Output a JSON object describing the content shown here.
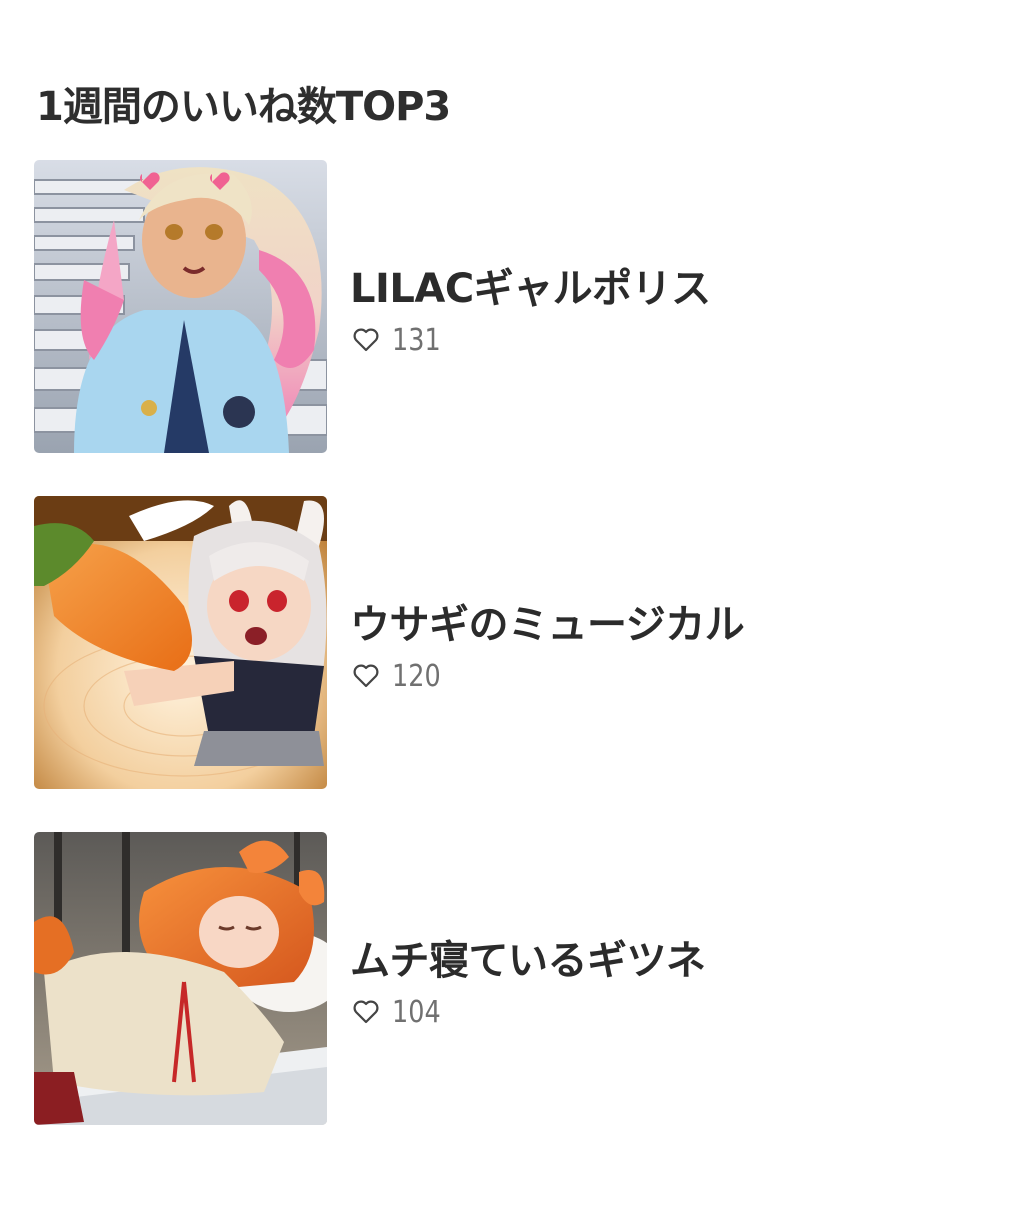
{
  "section": {
    "title": "1週間のいいね数TOP3"
  },
  "items": [
    {
      "title": "LILACギャルポリス",
      "likes": "131",
      "thumbnail_icon": "police-gal-illustration"
    },
    {
      "title": "ウサギのミュージカル",
      "likes": "120",
      "thumbnail_icon": "bunny-girl-carrot-illustration"
    },
    {
      "title": "ムチ寝ているギツネ",
      "likes": "104",
      "thumbnail_icon": "sleeping-fox-girl-illustration"
    }
  ],
  "colors": {
    "text": "#2b2b2b",
    "muted": "#707070",
    "background": "#ffffff"
  }
}
